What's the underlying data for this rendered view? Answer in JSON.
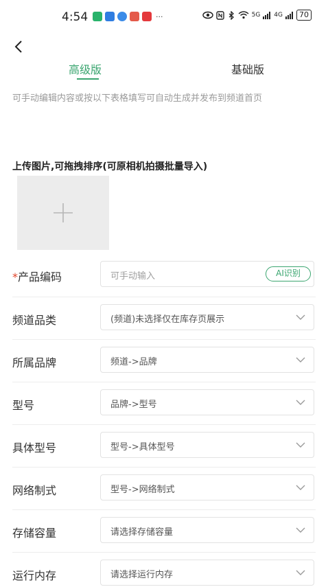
{
  "status_bar": {
    "time": "4:54",
    "more": "···",
    "network_1": "5G",
    "network_2": "4G",
    "battery": "70"
  },
  "tabs": [
    {
      "label": "高级版",
      "active": true
    },
    {
      "label": "基础版",
      "active": false
    }
  ],
  "hint": "可手动编辑内容或按以下表格填写可自动生成并发布到频道首页",
  "upload": {
    "title": "上传图片,可拖拽排序(可原相机拍摄批量导入)"
  },
  "form": {
    "product_code": {
      "required_mark": "*",
      "label": "产品编码",
      "placeholder": "可手动输入",
      "ai_button": "AI识别"
    },
    "rows": [
      {
        "label": "频道品类",
        "value": "(频道)未选择仅在库存页展示"
      },
      {
        "label": "所属品牌",
        "value": "频道->品牌"
      },
      {
        "label": "型号",
        "value": "品牌->型号"
      },
      {
        "label": "具体型号",
        "value": "型号->具体型号"
      },
      {
        "label": "网络制式",
        "value": "型号->网络制式"
      },
      {
        "label": "存储容量",
        "value": "请选择存储容量"
      },
      {
        "label": "运行内存",
        "value": "请选择运行内存"
      }
    ]
  },
  "colors": {
    "accent": "#3aa56f",
    "required": "#e0452b",
    "hint": "#9a9a9a"
  }
}
